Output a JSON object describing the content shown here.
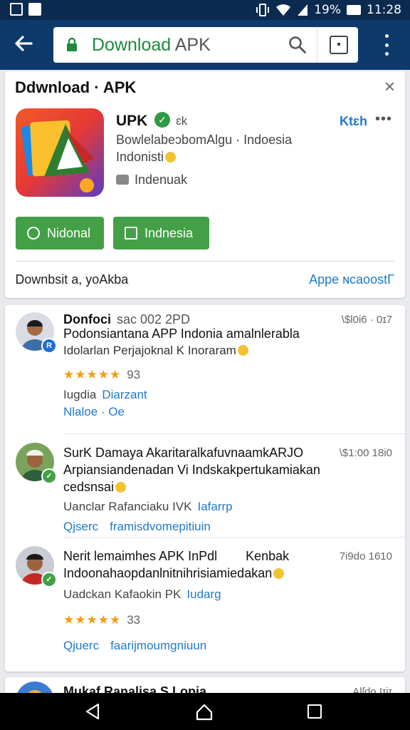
{
  "status_bar": {
    "battery": "19%",
    "time": "11:28"
  },
  "toolbar": {
    "url_green": "Download",
    "url_rest": " APK"
  },
  "app_card": {
    "title": "Ddwnload · APK",
    "close": "×",
    "app_name": "UPK",
    "extra": "ɛk",
    "right_link": "Ktɛh",
    "more": "•••",
    "developer": "BowlelabeɔbomAlgu ·",
    "country": "Indoesia",
    "category": "Indonisti",
    "rating_label": "Indenuak",
    "button_primary": "Nidonal",
    "button_secondary": "Indnesia",
    "footer_left": "Ꭰownbsit a, yoAkba",
    "footer_right": "Appe ɴcaoostΓ"
  },
  "reviews": [
    {
      "name": "Donfoci",
      "name_dim": "sac 002 2PD",
      "time": "\\$l0i6 · 0ɪ7",
      "text": "Podonsiantana APP Indonia amalnlerabla",
      "sub": "Idolarlan Perjajoknal K Inoraram",
      "stars": "★★★★★",
      "star_count": "93",
      "meta": "Iugdia",
      "meta_link": "Diarzant",
      "link": "Nlaloe · Oe",
      "badge": "R",
      "badge_color": "#1f6fd1"
    },
    {
      "name": "SurK Damaya Akaritaralkafuvnaamk",
      "name_dim": "ARJO",
      "time": "\\$1:00 18i0",
      "text": "Arpiansiandenadan Vi Indskakpertukamiakan",
      "text2": "cedsnsai",
      "meta": "Uanclar Rafanciaku IVK",
      "meta_link": "Iafarrp",
      "link_a": "Qjserc",
      "link_b": "framisdvomepitiuin",
      "badge": "✓",
      "badge_color": "#43a047"
    },
    {
      "name": "Nerit lemaimhes APK",
      "name_mid": "InPdl",
      "name_right": "Kenbak",
      "time": "7i9do 1610",
      "text": "Indoonahaopdanlnitnihrisiamiedakan",
      "meta": "Uadckan Kafaokin",
      "meta_dim": "PK",
      "meta_link": "Iudarg",
      "stars": "★★★★★",
      "star_count": "33",
      "link_a": "Qjuerc",
      "link_b": "faarijmoumgniuun",
      "badge": "✓",
      "badge_color": "#43a047"
    },
    {
      "name": "Mukaf Ranalisa S Lopia",
      "time": "Alʃdo Iɪiɪ"
    }
  ],
  "colors": {
    "status_bar": "#0a2a50",
    "toolbar": "#0d3a6b",
    "accent_green": "#43a047",
    "link_blue": "#1f7ac8",
    "star": "#f39c12"
  },
  "icons": [
    "arrow-back-icon",
    "lock-icon",
    "search-icon",
    "tab-switcher-icon",
    "overflow-menu-icon",
    "close-icon",
    "verified-icon",
    "thumb-icon",
    "nav-back-icon",
    "nav-home-icon",
    "nav-recents-icon"
  ]
}
